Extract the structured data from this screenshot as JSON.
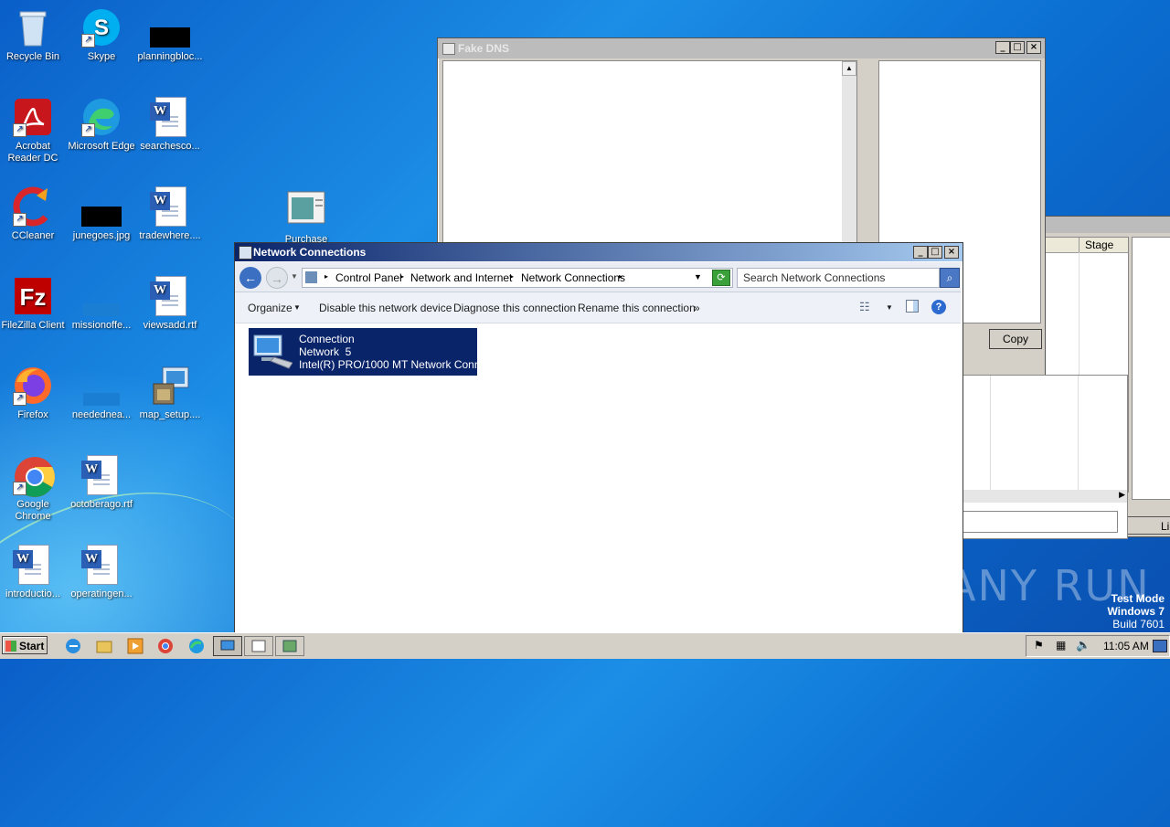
{
  "desktop": {
    "icons": [
      {
        "label": "Recycle Bin",
        "icon": "recycle-bin-icon"
      },
      {
        "label": "Skype",
        "icon": "skype-icon"
      },
      {
        "label": "planningbloc...",
        "icon": "image-file-icon"
      },
      {
        "label": "Acrobat Reader DC",
        "icon": "acrobat-icon"
      },
      {
        "label": "Microsoft Edge",
        "icon": "edge-icon"
      },
      {
        "label": "searchesco...",
        "icon": "word-doc-icon"
      },
      {
        "label": "CCleaner",
        "icon": "ccleaner-icon"
      },
      {
        "label": "junegoes.jpg",
        "icon": "image-file-icon"
      },
      {
        "label": "tradewhere....",
        "icon": "word-doc-icon"
      },
      {
        "label": "Purchase",
        "icon": "program-icon"
      },
      {
        "label": "FileZilla Client",
        "icon": "filezilla-icon"
      },
      {
        "label": "missionoffe...",
        "icon": "image-file-icon"
      },
      {
        "label": "viewsadd.rtf",
        "icon": "word-doc-icon"
      },
      {
        "label": "Firefox",
        "icon": "firefox-icon"
      },
      {
        "label": "neededneа...",
        "icon": "image-file-icon"
      },
      {
        "label": "map_setup....",
        "icon": "installer-icon"
      },
      {
        "label": "Google Chrome",
        "icon": "chrome-icon"
      },
      {
        "label": "octoberago.rtf",
        "icon": "word-doc-icon"
      },
      {
        "label": "introductio...",
        "icon": "word-doc-icon"
      },
      {
        "label": "operatingen...",
        "icon": "word-doc-icon"
      }
    ]
  },
  "fake_dns": {
    "title": "Fake DNS",
    "copy_button": "Copy"
  },
  "bg_window": {
    "column_header": "Stage",
    "button_partial": "Li"
  },
  "network_connections": {
    "title": "Network Connections",
    "breadcrumb": [
      "Control Panel",
      "Network and Internet",
      "Network Connections"
    ],
    "search_placeholder": "Search Network Connections",
    "commands": {
      "organize": "Organize",
      "disable": "Disable this network device",
      "diagnose": "Diagnose this connection",
      "rename": "Rename this connection",
      "more": "»"
    },
    "connection": {
      "name": "Connection",
      "network": "Network  5",
      "adapter": "Intel(R) PRO/1000 MT Network Conn..."
    }
  },
  "watermark": {
    "text": "ANY RUN",
    "test_mode": "Test Mode",
    "os": "Windows 7",
    "build": "Build 7601"
  },
  "taskbar": {
    "start": "Start",
    "clock": "11:05 AM"
  }
}
